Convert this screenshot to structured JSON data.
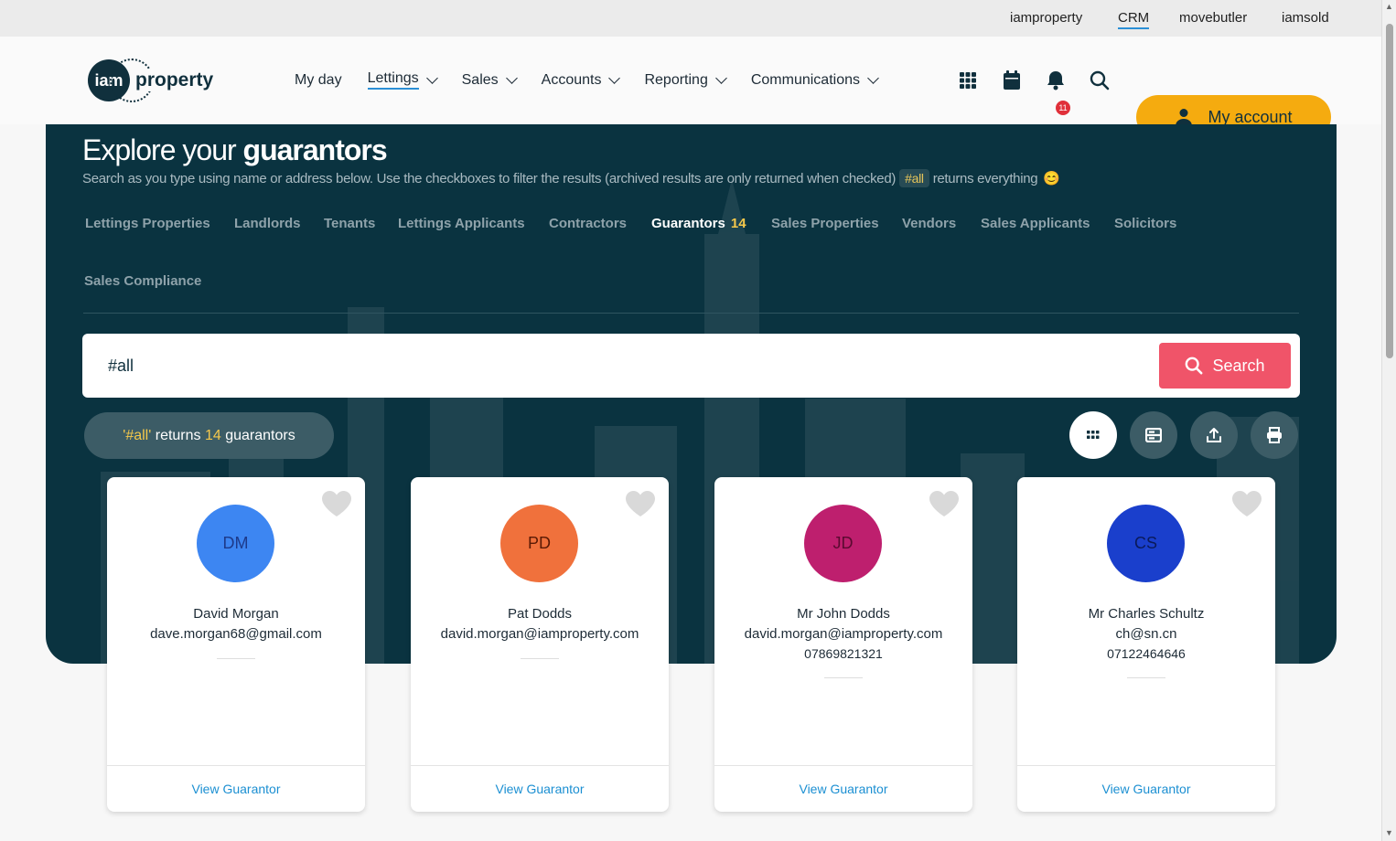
{
  "topbar": {
    "links": [
      {
        "label": "iamproperty",
        "active": false
      },
      {
        "label": "CRM",
        "active": true
      },
      {
        "label": "movebutler",
        "active": false
      },
      {
        "label": "iamsold",
        "active": false
      }
    ]
  },
  "header": {
    "logo_short": "iam",
    "logo_word": "property",
    "nav": [
      {
        "label": "My day",
        "dropdown": false
      },
      {
        "label": "Lettings",
        "dropdown": true,
        "active": true
      },
      {
        "label": "Sales",
        "dropdown": true
      },
      {
        "label": "Accounts",
        "dropdown": true
      },
      {
        "label": "Reporting",
        "dropdown": true
      },
      {
        "label": "Communications",
        "dropdown": true
      }
    ],
    "notification_count": "11",
    "account_label": "My account",
    "accent_color": "#f5ab0f"
  },
  "hero": {
    "title_light": "Explore your ",
    "title_bold": "guarantors",
    "subtitle_before": "Search as you type using name or address below. Use the checkboxes to filter the results (archived results are only returned when checked)",
    "subtitle_tag": "#all",
    "subtitle_after": "returns everything",
    "subtitle_emoji": "😊",
    "tabs": [
      {
        "label": "Lettings Properties"
      },
      {
        "label": "Landlords"
      },
      {
        "label": "Tenants"
      },
      {
        "label": "Lettings Applicants"
      },
      {
        "label": "Contractors"
      },
      {
        "label": "Guarantors",
        "count": "14",
        "active": true
      },
      {
        "label": "Sales Properties"
      },
      {
        "label": "Vendors"
      },
      {
        "label": "Sales Applicants"
      },
      {
        "label": "Solicitors"
      },
      {
        "label": "Sales Compliance"
      }
    ]
  },
  "search": {
    "value": "#all",
    "button_label": "Search",
    "button_color": "#f05469"
  },
  "results": {
    "query": "'#all'",
    "returns_text": "returns",
    "count": "14",
    "noun": "guarantors"
  },
  "view_buttons": [
    {
      "icon": "grid-view-icon",
      "active": true
    },
    {
      "icon": "list-view-icon",
      "active": false
    },
    {
      "icon": "export-icon",
      "active": false
    },
    {
      "icon": "print-icon",
      "active": false
    }
  ],
  "cards": [
    {
      "initials": "DM",
      "avatar_color": "#3d86f2",
      "initials_color": "#1d3a8a",
      "name": "David Morgan",
      "email": "dave.morgan68@gmail.com",
      "phone": "",
      "link": "View Guarantor"
    },
    {
      "initials": "PD",
      "avatar_color": "#f0713c",
      "initials_color": "#5a1a05",
      "name": "Pat Dodds",
      "email": "david.morgan@iamproperty.com",
      "phone": "",
      "link": "View Guarantor"
    },
    {
      "initials": "JD",
      "avatar_color": "#be1f6e",
      "initials_color": "#5a0a30",
      "name": "Mr John Dodds",
      "email": "david.morgan@iamproperty.com",
      "phone": "07869821321",
      "link": "View Guarantor"
    },
    {
      "initials": "CS",
      "avatar_color": "#1a3fcc",
      "initials_color": "#0a1a5a",
      "name": "Mr Charles Schultz",
      "email": "ch@sn.cn",
      "phone": "07122464646",
      "link": "View Guarantor"
    }
  ]
}
